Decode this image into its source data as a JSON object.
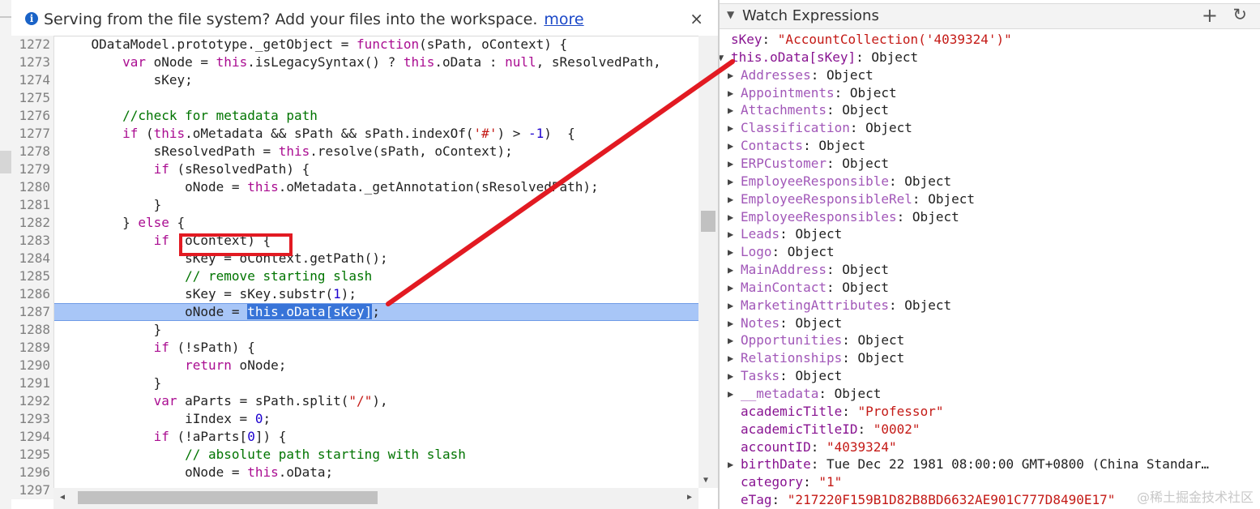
{
  "infobar": {
    "icon": "info-icon",
    "message": "Serving from the file system? Add your files into the workspace.",
    "link": "more",
    "close": "×"
  },
  "code": {
    "lines": [
      {
        "n": "1272",
        "t": [
          [
            "",
            "    ODataModel.prototype._getObject = "
          ],
          [
            "kw",
            "function"
          ],
          [
            "",
            "(sPath, oContext) {"
          ]
        ]
      },
      {
        "n": "1273",
        "t": [
          [
            "",
            "        "
          ],
          [
            "kw",
            "var"
          ],
          [
            "",
            " oNode = "
          ],
          [
            "kw",
            "this"
          ],
          [
            "",
            ".isLegacySyntax() ? "
          ],
          [
            "kw",
            "this"
          ],
          [
            "",
            ".oData : "
          ],
          [
            "kw",
            "null"
          ],
          [
            "",
            ", sResolvedPath,"
          ]
        ]
      },
      {
        "n": "1274",
        "t": [
          [
            "",
            "            sKey;"
          ]
        ]
      },
      {
        "n": "1275",
        "t": [
          [
            "",
            ""
          ]
        ]
      },
      {
        "n": "1276",
        "t": [
          [
            "cm",
            "        //check for metadata path"
          ]
        ]
      },
      {
        "n": "1277",
        "t": [
          [
            "",
            "        "
          ],
          [
            "kw",
            "if"
          ],
          [
            "",
            " ("
          ],
          [
            "kw",
            "this"
          ],
          [
            "",
            ".oMetadata && sPath && sPath.indexOf("
          ],
          [
            "str",
            "'#'"
          ],
          [
            "",
            ") > "
          ],
          [
            "num",
            "-1"
          ],
          [
            "",
            ")  {"
          ]
        ]
      },
      {
        "n": "1278",
        "t": [
          [
            "",
            "            sResolvedPath = "
          ],
          [
            "kw",
            "this"
          ],
          [
            "",
            ".resolve(sPath, oContext);"
          ]
        ]
      },
      {
        "n": "1279",
        "t": [
          [
            "",
            "            "
          ],
          [
            "kw",
            "if"
          ],
          [
            "",
            " (sResolvedPath) {"
          ]
        ]
      },
      {
        "n": "1280",
        "t": [
          [
            "",
            "                oNode = "
          ],
          [
            "kw",
            "this"
          ],
          [
            "",
            ".oMetadata._getAnnotation(sResolvedPath);"
          ]
        ]
      },
      {
        "n": "1281",
        "t": [
          [
            "",
            "            }"
          ]
        ]
      },
      {
        "n": "1282",
        "t": [
          [
            "",
            "        } "
          ],
          [
            "kw",
            "else"
          ],
          [
            "",
            " {"
          ]
        ]
      },
      {
        "n": "1283",
        "t": [
          [
            "",
            "            "
          ],
          [
            "kw",
            "if"
          ],
          [
            "",
            " (oContext) {"
          ]
        ]
      },
      {
        "n": "1284",
        "t": [
          [
            "",
            "                sKey = oContext.getPath();"
          ]
        ]
      },
      {
        "n": "1285",
        "t": [
          [
            "cm",
            "                // remove starting slash"
          ]
        ]
      },
      {
        "n": "1286",
        "t": [
          [
            "",
            "                sKey = sKey.substr("
          ],
          [
            "num",
            "1"
          ],
          [
            "",
            ");"
          ]
        ]
      },
      {
        "n": "1287",
        "t": [
          [
            "",
            "                oNode = "
          ],
          [
            "sel",
            "this.oData[sKey]"
          ],
          [
            "",
            ";"
          ]
        ],
        "highlight": true
      },
      {
        "n": "1288",
        "t": [
          [
            "",
            "            }"
          ]
        ]
      },
      {
        "n": "1289",
        "t": [
          [
            "",
            "            "
          ],
          [
            "kw",
            "if"
          ],
          [
            "",
            " (!sPath) {"
          ]
        ]
      },
      {
        "n": "1290",
        "t": [
          [
            "",
            "                "
          ],
          [
            "kw",
            "return"
          ],
          [
            "",
            " oNode;"
          ]
        ]
      },
      {
        "n": "1291",
        "t": [
          [
            "",
            "            }"
          ]
        ]
      },
      {
        "n": "1292",
        "t": [
          [
            "",
            "            "
          ],
          [
            "kw",
            "var"
          ],
          [
            "",
            " aParts = sPath.split("
          ],
          [
            "str",
            "\"/\""
          ],
          [
            "",
            "),"
          ]
        ]
      },
      {
        "n": "1293",
        "t": [
          [
            "",
            "                iIndex = "
          ],
          [
            "num",
            "0"
          ],
          [
            "",
            ";"
          ]
        ]
      },
      {
        "n": "1294",
        "t": [
          [
            "",
            "            "
          ],
          [
            "kw",
            "if"
          ],
          [
            "",
            " (!aParts["
          ],
          [
            "num",
            "0"
          ],
          [
            "",
            "]) {"
          ]
        ]
      },
      {
        "n": "1295",
        "t": [
          [
            "cm",
            "                // absolute path starting with slash"
          ]
        ]
      },
      {
        "n": "1296",
        "t": [
          [
            "",
            "                oNode = "
          ],
          [
            "kw",
            "this"
          ],
          [
            "",
            ".oData;"
          ]
        ]
      },
      {
        "n": "1297",
        "t": [
          [
            "",
            ""
          ]
        ]
      }
    ]
  },
  "annotation": {
    "stroke": "#e21a22"
  },
  "watch": {
    "title": "Watch Expressions",
    "add": "+",
    "refresh": "↻",
    "rows": [
      {
        "tri": "",
        "indent": 0,
        "name": "sKey",
        "sep": ": ",
        "val": "\"AccountCollection('4039324')\"",
        "vt": "str",
        "nameClass": "w-top-name"
      },
      {
        "tri": "▼",
        "indent": 0,
        "name": "this.oData[sKey]",
        "sep": ": ",
        "val": "Object",
        "vt": "val",
        "nameClass": "w-top-name"
      },
      {
        "tri": "▶",
        "indent": 1,
        "name": "Addresses",
        "sep": ": ",
        "val": "Object",
        "vt": "val",
        "nameClass": "w-name dim"
      },
      {
        "tri": "▶",
        "indent": 1,
        "name": "Appointments",
        "sep": ": ",
        "val": "Object",
        "vt": "val",
        "nameClass": "w-name dim"
      },
      {
        "tri": "▶",
        "indent": 1,
        "name": "Attachments",
        "sep": ": ",
        "val": "Object",
        "vt": "val",
        "nameClass": "w-name dim"
      },
      {
        "tri": "▶",
        "indent": 1,
        "name": "Classification",
        "sep": ": ",
        "val": "Object",
        "vt": "val",
        "nameClass": "w-name dim"
      },
      {
        "tri": "▶",
        "indent": 1,
        "name": "Contacts",
        "sep": ": ",
        "val": "Object",
        "vt": "val",
        "nameClass": "w-name dim"
      },
      {
        "tri": "▶",
        "indent": 1,
        "name": "ERPCustomer",
        "sep": ": ",
        "val": "Object",
        "vt": "val",
        "nameClass": "w-name dim"
      },
      {
        "tri": "▶",
        "indent": 1,
        "name": "EmployeeResponsible",
        "sep": ": ",
        "val": "Object",
        "vt": "val",
        "nameClass": "w-name dim"
      },
      {
        "tri": "▶",
        "indent": 1,
        "name": "EmployeeResponsibleRel",
        "sep": ": ",
        "val": "Object",
        "vt": "val",
        "nameClass": "w-name dim"
      },
      {
        "tri": "▶",
        "indent": 1,
        "name": "EmployeeResponsibles",
        "sep": ": ",
        "val": "Object",
        "vt": "val",
        "nameClass": "w-name dim"
      },
      {
        "tri": "▶",
        "indent": 1,
        "name": "Leads",
        "sep": ": ",
        "val": "Object",
        "vt": "val",
        "nameClass": "w-name dim"
      },
      {
        "tri": "▶",
        "indent": 1,
        "name": "Logo",
        "sep": ": ",
        "val": "Object",
        "vt": "val",
        "nameClass": "w-name dim"
      },
      {
        "tri": "▶",
        "indent": 1,
        "name": "MainAddress",
        "sep": ": ",
        "val": "Object",
        "vt": "val",
        "nameClass": "w-name dim"
      },
      {
        "tri": "▶",
        "indent": 1,
        "name": "MainContact",
        "sep": ": ",
        "val": "Object",
        "vt": "val",
        "nameClass": "w-name dim"
      },
      {
        "tri": "▶",
        "indent": 1,
        "name": "MarketingAttributes",
        "sep": ": ",
        "val": "Object",
        "vt": "val",
        "nameClass": "w-name dim"
      },
      {
        "tri": "▶",
        "indent": 1,
        "name": "Notes",
        "sep": ": ",
        "val": "Object",
        "vt": "val",
        "nameClass": "w-name dim"
      },
      {
        "tri": "▶",
        "indent": 1,
        "name": "Opportunities",
        "sep": ": ",
        "val": "Object",
        "vt": "val",
        "nameClass": "w-name dim"
      },
      {
        "tri": "▶",
        "indent": 1,
        "name": "Relationships",
        "sep": ": ",
        "val": "Object",
        "vt": "val",
        "nameClass": "w-name dim"
      },
      {
        "tri": "▶",
        "indent": 1,
        "name": "Tasks",
        "sep": ": ",
        "val": "Object",
        "vt": "val",
        "nameClass": "w-name dim"
      },
      {
        "tri": "▶",
        "indent": 1,
        "name": "__metadata",
        "sep": ": ",
        "val": "Object",
        "vt": "val",
        "nameClass": "w-name dim"
      },
      {
        "tri": "",
        "indent": 1,
        "name": "academicTitle",
        "sep": ": ",
        "val": "\"Professor\"",
        "vt": "str",
        "nameClass": "w-name"
      },
      {
        "tri": "",
        "indent": 1,
        "name": "academicTitleID",
        "sep": ": ",
        "val": "\"0002\"",
        "vt": "str",
        "nameClass": "w-name"
      },
      {
        "tri": "",
        "indent": 1,
        "name": "accountID",
        "sep": ": ",
        "val": "\"4039324\"",
        "vt": "str",
        "nameClass": "w-name"
      },
      {
        "tri": "▶",
        "indent": 1,
        "name": "birthDate",
        "sep": ": ",
        "val": "Tue Dec 22 1981 08:00:00 GMT+0800 (China Standar…",
        "vt": "val",
        "nameClass": "w-name"
      },
      {
        "tri": "",
        "indent": 1,
        "name": "category",
        "sep": ": ",
        "val": "\"1\"",
        "vt": "str",
        "nameClass": "w-name"
      },
      {
        "tri": "",
        "indent": 1,
        "name": "eTag",
        "sep": ": ",
        "val": "\"217220F159B1D82B8BD6632AE901C777D8490E17\"",
        "vt": "str",
        "nameClass": "w-name"
      }
    ]
  },
  "watermark": "@稀土掘金技术社区"
}
